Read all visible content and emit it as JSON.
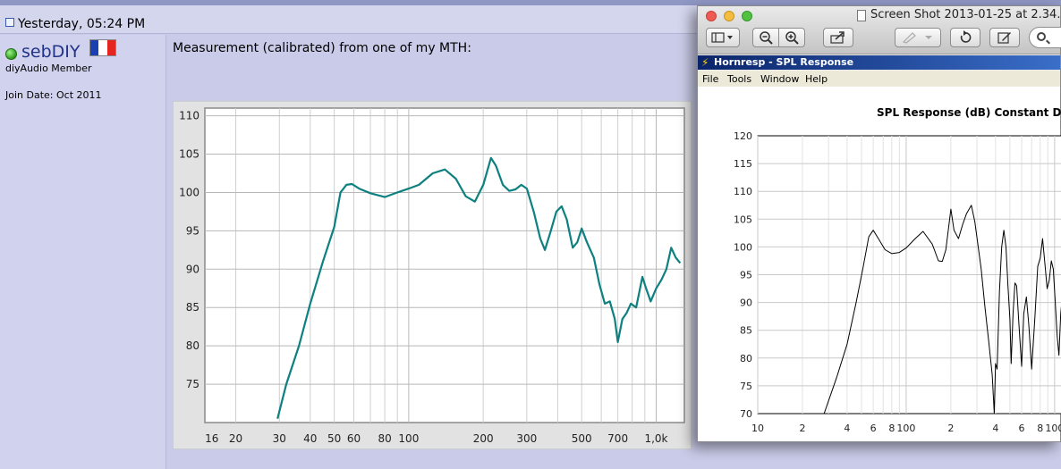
{
  "post": {
    "date": "Yesterday, 05:24 PM",
    "username": "sebDIY",
    "user_title": "diyAudio Member",
    "join_date": "Join Date: Oct 2011",
    "text": "Measurement (calibrated) from one of my MTH:"
  },
  "colors": {
    "measurement_line": "#0e8080",
    "flag": [
      "#1a3fb0",
      "#ffffff",
      "#e3241f"
    ]
  },
  "mac_window": {
    "title": "Screen Shot 2013-01-25 at 2.34.",
    "toolbar_icons": [
      "sidebar-toggle-icon",
      "zoom-out-icon",
      "zoom-in-icon",
      "share-icon",
      "annotate-icon",
      "rotate-icon",
      "edit-icon",
      "search-icon"
    ]
  },
  "hornresp": {
    "title": "Hornresp - SPL Response",
    "menu": [
      "File",
      "Tools",
      "Window",
      "Help"
    ],
    "heading": "SPL Response (dB)   Constant Direc"
  },
  "chart_data": [
    {
      "type": "line",
      "title": "",
      "xlabel": "",
      "ylabel": "",
      "x_scale": "log",
      "xlim": [
        15,
        1300
      ],
      "ylim": [
        70,
        111
      ],
      "grid": true,
      "x_tick_labels": [
        {
          "v": 16,
          "label": "16"
        },
        {
          "v": 20,
          "label": "20"
        },
        {
          "v": 30,
          "label": "30"
        },
        {
          "v": 40,
          "label": "40"
        },
        {
          "v": 50,
          "label": "50"
        },
        {
          "v": 60,
          "label": "60"
        },
        {
          "v": 80,
          "label": "80"
        },
        {
          "v": 100,
          "label": "100"
        },
        {
          "v": 200,
          "label": "200"
        },
        {
          "v": 300,
          "label": "300"
        },
        {
          "v": 500,
          "label": "500"
        },
        {
          "v": 700,
          "label": "700"
        },
        {
          "v": 1000,
          "label": "1,0k"
        }
      ],
      "y_ticks": [
        75,
        80,
        85,
        90,
        95,
        100,
        105,
        110
      ],
      "series": [
        {
          "points": [
            [
              29.5,
              70.5
            ],
            [
              32,
              75
            ],
            [
              36,
              80
            ],
            [
              40,
              85.5
            ],
            [
              45,
              91
            ],
            [
              50,
              95.5
            ],
            [
              53,
              100
            ],
            [
              56,
              101
            ],
            [
              59,
              101.1
            ],
            [
              63,
              100.5
            ],
            [
              70,
              99.9
            ],
            [
              80,
              99.4
            ],
            [
              90,
              100
            ],
            [
              100,
              100.5
            ],
            [
              110,
              101
            ],
            [
              125,
              102.5
            ],
            [
              140,
              103
            ],
            [
              155,
              101.8
            ],
            [
              170,
              99.5
            ],
            [
              185,
              98.8
            ],
            [
              200,
              101
            ],
            [
              215,
              104.5
            ],
            [
              225,
              103.5
            ],
            [
              240,
              101
            ],
            [
              255,
              100.2
            ],
            [
              270,
              100.4
            ],
            [
              285,
              101
            ],
            [
              300,
              100.5
            ],
            [
              320,
              97.5
            ],
            [
              340,
              94
            ],
            [
              355,
              92.5
            ],
            [
              375,
              95
            ],
            [
              395,
              97.5
            ],
            [
              415,
              98.2
            ],
            [
              435,
              96.5
            ],
            [
              460,
              92.8
            ],
            [
              480,
              93.5
            ],
            [
              500,
              95.3
            ],
            [
              525,
              93.5
            ],
            [
              560,
              91.5
            ],
            [
              590,
              88
            ],
            [
              620,
              85.5
            ],
            [
              650,
              85.8
            ],
            [
              680,
              83.5
            ],
            [
              700,
              80.5
            ],
            [
              730,
              83.5
            ],
            [
              760,
              84.3
            ],
            [
              790,
              85.5
            ],
            [
              830,
              85
            ],
            [
              880,
              89
            ],
            [
              910,
              87.5
            ],
            [
              950,
              85.8
            ],
            [
              1000,
              87.5
            ],
            [
              1050,
              88.6
            ],
            [
              1100,
              90
            ],
            [
              1150,
              92.8
            ],
            [
              1200,
              91.5
            ],
            [
              1250,
              90.8
            ]
          ]
        }
      ]
    },
    {
      "type": "line",
      "title": "SPL Response (dB)   Constant Direc",
      "xlabel": "",
      "ylabel": "",
      "x_scale": "log",
      "xlim": [
        10,
        1200
      ],
      "ylim": [
        70,
        120
      ],
      "grid": true,
      "x_tick_labels": [
        {
          "v": 10,
          "label": "10"
        },
        {
          "v": 20,
          "label": "2"
        },
        {
          "v": 40,
          "label": "4"
        },
        {
          "v": 60,
          "label": "6"
        },
        {
          "v": 80,
          "label": "8"
        },
        {
          "v": 100,
          "label": "100"
        },
        {
          "v": 200,
          "label": "2"
        },
        {
          "v": 400,
          "label": "4"
        },
        {
          "v": 600,
          "label": "6"
        },
        {
          "v": 800,
          "label": "8"
        },
        {
          "v": 1000,
          "label": "100"
        }
      ],
      "y_ticks": [
        70,
        75,
        80,
        85,
        90,
        95,
        100,
        105,
        110,
        115,
        120
      ],
      "series": [
        {
          "points": [
            [
              28,
              70
            ],
            [
              34,
              76.5
            ],
            [
              40,
              82.5
            ],
            [
              46,
              90
            ],
            [
              51,
              96
            ],
            [
              56,
              101.8
            ],
            [
              60,
              103
            ],
            [
              65,
              101.5
            ],
            [
              72,
              99.5
            ],
            [
              80,
              98.8
            ],
            [
              90,
              99
            ],
            [
              100,
              99.8
            ],
            [
              115,
              101.5
            ],
            [
              130,
              102.8
            ],
            [
              150,
              100.5
            ],
            [
              165,
              97.5
            ],
            [
              175,
              97.4
            ],
            [
              185,
              99.5
            ],
            [
              200,
              106.8
            ],
            [
              210,
              103
            ],
            [
              225,
              101.5
            ],
            [
              240,
              104
            ],
            [
              255,
              106
            ],
            [
              275,
              107.5
            ],
            [
              290,
              104.5
            ],
            [
              305,
              100.2
            ],
            [
              320,
              96
            ],
            [
              340,
              89
            ],
            [
              360,
              83
            ],
            [
              380,
              77
            ],
            [
              392,
              70
            ],
            [
              400,
              79
            ],
            [
              410,
              78
            ],
            [
              425,
              92
            ],
            [
              440,
              100
            ],
            [
              455,
              103
            ],
            [
              470,
              100
            ],
            [
              485,
              93
            ],
            [
              500,
              87
            ],
            [
              510,
              79
            ],
            [
              525,
              88
            ],
            [
              540,
              93.5
            ],
            [
              555,
              93
            ],
            [
              575,
              86
            ],
            [
              600,
              78.5
            ],
            [
              620,
              88
            ],
            [
              645,
              91
            ],
            [
              670,
              86
            ],
            [
              700,
              78
            ],
            [
              735,
              87
            ],
            [
              770,
              96.5
            ],
            [
              800,
              98
            ],
            [
              830,
              101.5
            ],
            [
              860,
              97
            ],
            [
              890,
              92.5
            ],
            [
              920,
              94
            ],
            [
              950,
              97.5
            ],
            [
              980,
              96
            ],
            [
              1010,
              90
            ],
            [
              1040,
              84
            ],
            [
              1070,
              80.5
            ],
            [
              1100,
              88
            ],
            [
              1140,
              92.5
            ],
            [
              1180,
              90
            ]
          ]
        }
      ]
    }
  ]
}
